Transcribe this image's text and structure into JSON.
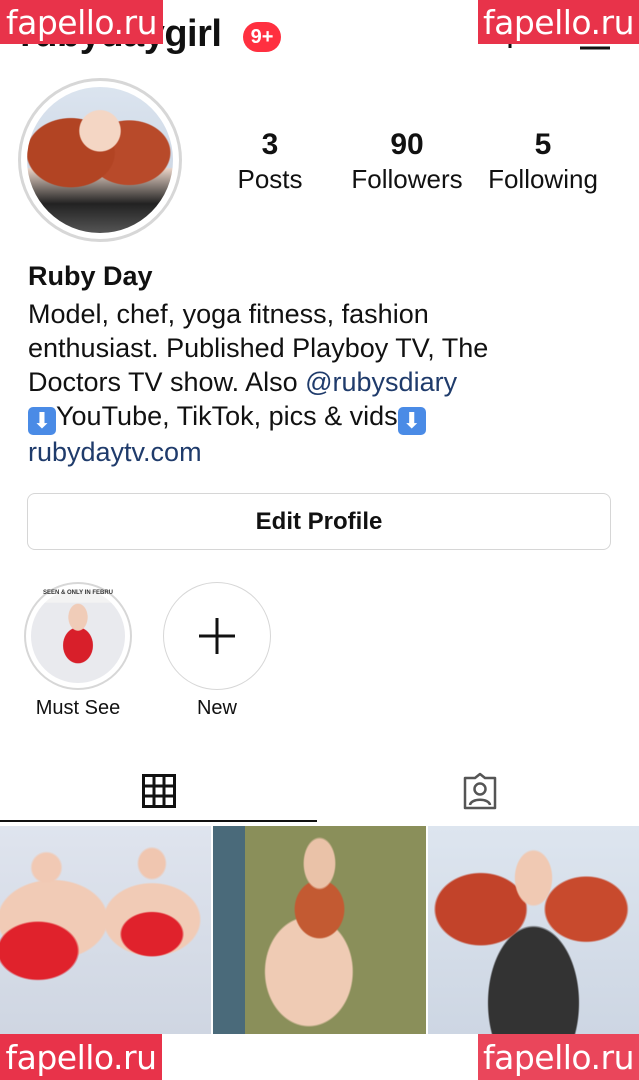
{
  "header": {
    "username": "rubydaygirl",
    "notification_badge": "9+"
  },
  "watermarks": [
    "fapello.ru",
    "fapello.ru",
    "fapello.ru",
    "fapello.ru"
  ],
  "stats": [
    {
      "value": "3",
      "label": "Posts"
    },
    {
      "value": "90",
      "label": "Followers"
    },
    {
      "value": "5",
      "label": "Following"
    }
  ],
  "profile": {
    "display_name": "Ruby Day",
    "bio_line1": "Model, chef, yoga fitness, fashion",
    "bio_line2": "enthusiast.  Published Playboy TV, The",
    "bio_line3_prefix": "Doctors TV show.  Also ",
    "bio_mention": "@rubysdiary",
    "bio_line4_text": "YouTube, TikTok, pics & vids",
    "arrow_emoji": "⬇",
    "website": "rubydaytv.com"
  },
  "actions": {
    "edit_profile": "Edit Profile"
  },
  "highlights": [
    {
      "label": "Must See",
      "cover_text": "SEEN & ONLY IN FEBRU"
    },
    {
      "label": "New"
    }
  ],
  "icons": {
    "new_post": "plus-icon",
    "menu": "menu-icon",
    "grid_tab": "grid-icon",
    "tagged_tab": "tagged-person-icon"
  },
  "colors": {
    "badge": "#ff3040",
    "watermark": "#e8334a",
    "link": "#1f3b6b"
  }
}
